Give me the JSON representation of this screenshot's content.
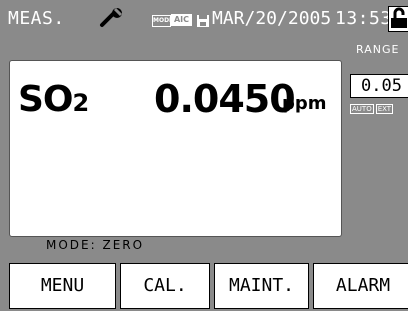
{
  "status": {
    "mode_label": "MEAS.",
    "mode_badge": "MODE",
    "aic_badge": "AIC",
    "date": "MAR/20/2005",
    "time": "13:53"
  },
  "range": {
    "label": "RANGE",
    "value": "0.05",
    "auto": "AUTO",
    "ext": "EXT"
  },
  "measurement": {
    "gas_main": "SO",
    "gas_sub": "2",
    "value": "0.0450",
    "unit": "ppm"
  },
  "mode_line": "MODE: ZERO",
  "buttons": {
    "menu": "MENU",
    "cal": "CAL.",
    "maint": "MAINT.",
    "alarm": "ALARM"
  },
  "icons": [
    "wrench-icon",
    "disk-icon",
    "lock-icon"
  ]
}
